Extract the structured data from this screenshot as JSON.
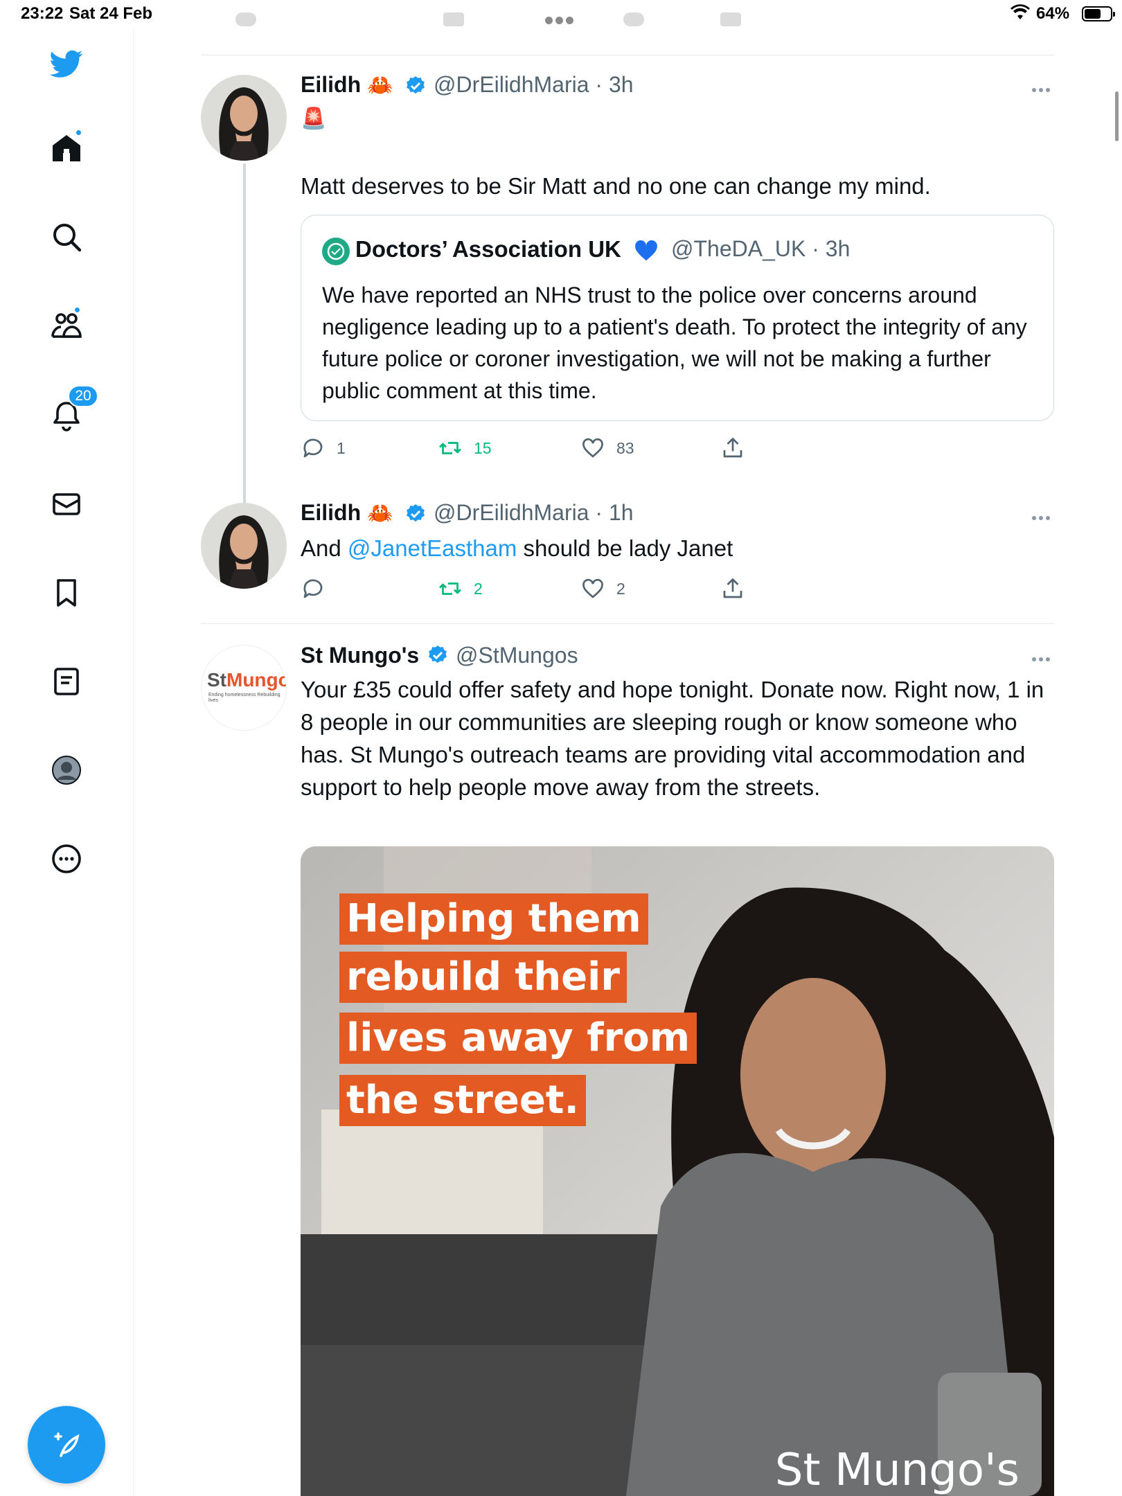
{
  "status_bar": {
    "time": "23:22",
    "date": "Sat 24 Feb",
    "battery": "64%",
    "battery_level": 0.64
  },
  "sidebar": {
    "notifications_badge": "20",
    "items": [
      "home",
      "explore",
      "communities",
      "notifications",
      "messages",
      "bookmarks",
      "lists",
      "profile",
      "more"
    ]
  },
  "tweets": [
    {
      "name": "Eilidh",
      "name_emoji": "🦀",
      "handle": "@DrEilidhMaria · 3h",
      "emoji_line": "🚨",
      "text": "Matt deserves to be Sir Matt and no one can change my mind.",
      "quote": {
        "name": "Doctors’ Association UK",
        "handle": "@TheDA_UK · 3h",
        "text": "We have reported an NHS trust to the police over concerns around negligence leading up to a patient's death. To protect the integrity of any future police or coroner investigation, we will not be making a further public comment at this time."
      },
      "replies": "1",
      "retweets": "15",
      "likes": "83"
    },
    {
      "name": "Eilidh",
      "name_emoji": "🦀",
      "handle": "@DrEilidhMaria · 1h",
      "text_before": "And ",
      "mention": "@JanetEastham",
      "text_after": " should be lady Janet",
      "replies": "",
      "retweets": "2",
      "likes": "2"
    },
    {
      "name": "St Mungo's",
      "handle": "@StMungos",
      "avatar_logo_st": "St",
      "avatar_logo_mungos": "Mungo's",
      "avatar_tagline": "Ending homelessness Rebuilding lives",
      "text": "Your £35 could offer safety and hope tonight. Donate now. Right now, 1 in 8 people in our communities are sleeping rough or know someone who has. St Mungo's outreach teams are providing vital accommodation and support to help people move away from the streets.",
      "media": {
        "caption_lines": [
          "Helping them",
          "rebuild their",
          "lives away from",
          "the street."
        ],
        "watermark": "St Mungo's"
      }
    }
  ]
}
